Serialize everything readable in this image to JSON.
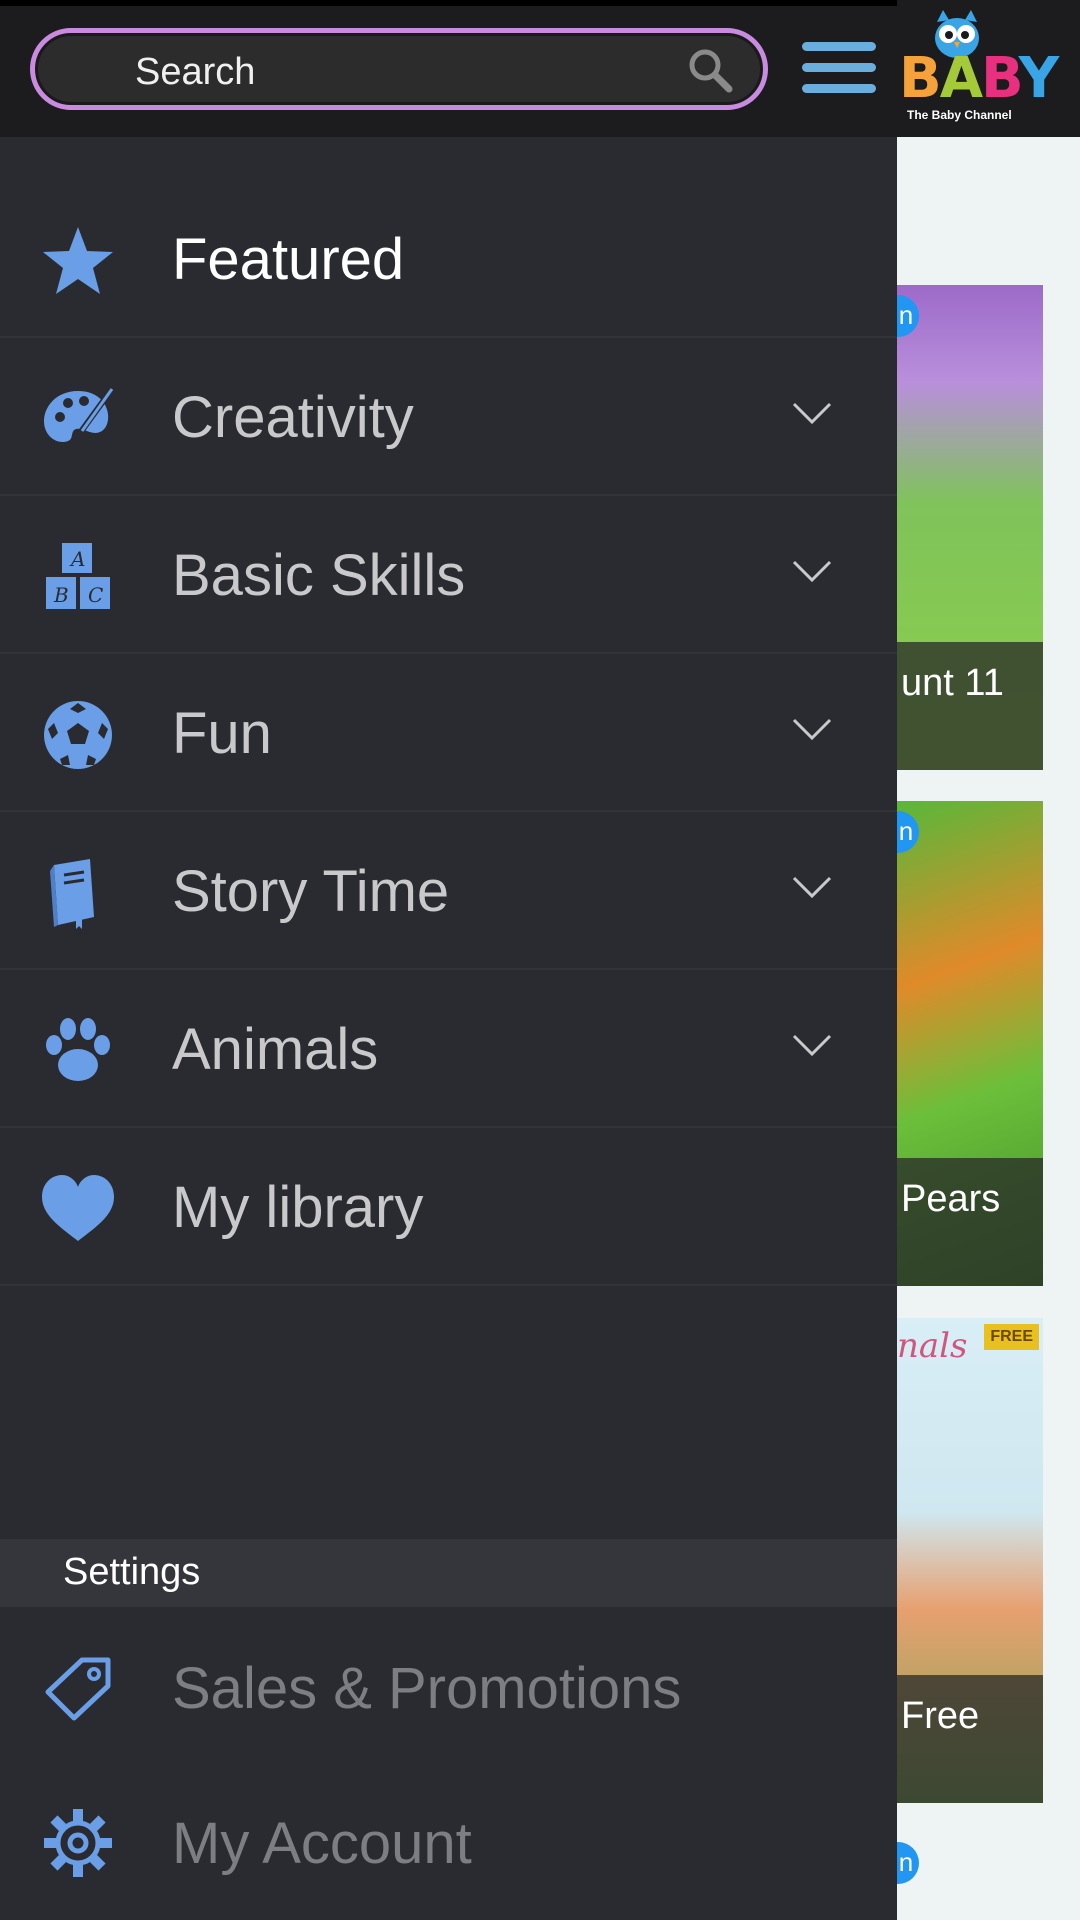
{
  "search": {
    "placeholder": "Search",
    "icon": "search-icon"
  },
  "header": {
    "menu_icon": "hamburger-menu-icon",
    "logo_word": [
      "B",
      "A",
      "B",
      "Y"
    ],
    "logo_subtitle": "The Baby Channel"
  },
  "colors": {
    "accent": "#6aaedd",
    "search_border": "#c98be0",
    "drawer_bg": "#2a2b30",
    "icon_blue": "#6a9ee6"
  },
  "nav": [
    {
      "label": "Featured",
      "icon": "star-icon",
      "expandable": false
    },
    {
      "label": "Creativity",
      "icon": "palette-icon",
      "expandable": true
    },
    {
      "label": "Basic Skills",
      "icon": "abc-blocks-icon",
      "expandable": true
    },
    {
      "label": "Fun",
      "icon": "soccer-ball-icon",
      "expandable": true
    },
    {
      "label": "Story Time",
      "icon": "book-icon",
      "expandable": true
    },
    {
      "label": "Animals",
      "icon": "paw-icon",
      "expandable": true
    },
    {
      "label": "My library",
      "icon": "heart-icon",
      "expandable": false
    }
  ],
  "settings": {
    "header": "Settings",
    "items": [
      {
        "label": "Sales & Promotions",
        "icon": "tag-icon"
      },
      {
        "label": "My Account",
        "icon": "gear-icon"
      }
    ]
  },
  "background_cards": [
    {
      "label": "unt 11",
      "badge": "n"
    },
    {
      "label": "Pears",
      "badge": "n"
    },
    {
      "label": "Free",
      "corner_text": "FREE",
      "title_fragment": "nals"
    },
    {
      "badge": "n"
    }
  ]
}
